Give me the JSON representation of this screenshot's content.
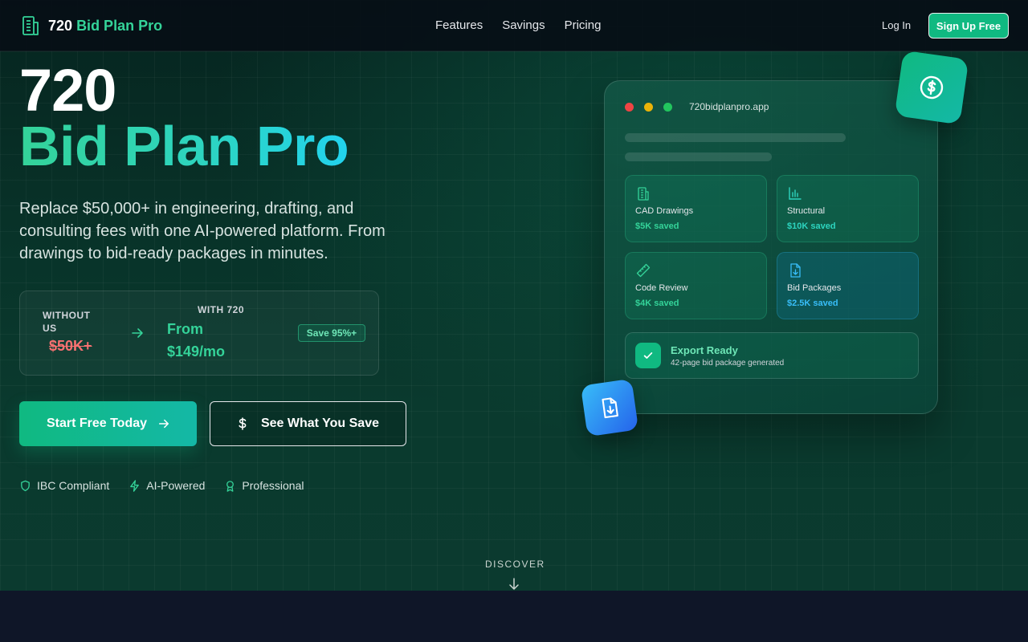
{
  "nav": {
    "brand_number": "720",
    "brand_name": "Bid Plan Pro",
    "links": [
      "Features",
      "Savings",
      "Pricing"
    ],
    "login": "Log In",
    "signup": "Sign Up Free"
  },
  "hero": {
    "title_line1": "720",
    "title_line2": "Bid Plan Pro",
    "subtitle": "Replace $50,000+ in engineering, drafting, and consulting fees with one AI-powered platform. From drawings to bid-ready packages in minutes.",
    "compare": {
      "without_label": "WITHOUT US",
      "without_value": "$50K+",
      "with_label": "WITH 720",
      "with_value": "From $149/mo",
      "badge": "Save 95%+"
    },
    "cta_primary": "Start Free Today",
    "cta_secondary": "See What You Save",
    "trust": [
      "IBC Compliant",
      "AI-Powered",
      "Professional"
    ],
    "discover": "DISCOVER"
  },
  "mockup": {
    "url": "720bidplanpro.app",
    "tiles": [
      {
        "title": "CAD Drawings",
        "value": "$5K saved",
        "icon": "building-icon"
      },
      {
        "title": "Structural",
        "value": "$10K saved",
        "icon": "bar-chart-icon"
      },
      {
        "title": "Code Review",
        "value": "$4K saved",
        "icon": "ruler-icon"
      },
      {
        "title": "Bid Packages",
        "value": "$2.5K saved",
        "icon": "file-download-icon"
      }
    ],
    "export_title": "Export Ready",
    "export_sub": "42-page bid package generated"
  },
  "colors": {
    "accent": "#10b981",
    "accent_light": "#34d399",
    "cyan": "#22d3ee",
    "danger": "#f87171",
    "blue": "#38bdf8"
  }
}
